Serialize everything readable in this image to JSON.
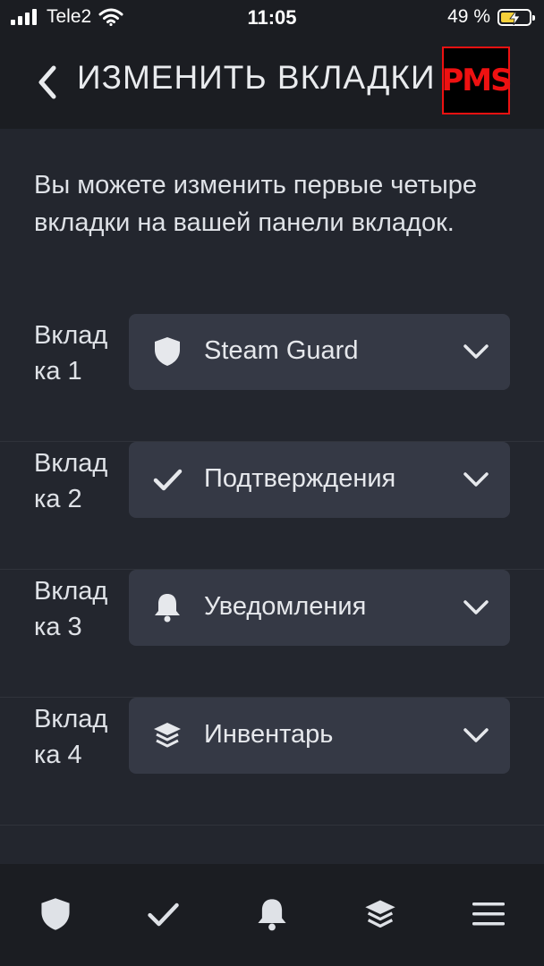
{
  "status_bar": {
    "carrier": "Tele2",
    "time": "11:05",
    "battery_percent": "49 %",
    "icons": [
      "signal-icon",
      "wifi-icon",
      "battery-charging-icon"
    ]
  },
  "header": {
    "back_icon": "chevron-left-icon",
    "title": "ИЗМЕНИТЬ ВКЛАДКИ",
    "logo_text": "PMS"
  },
  "intro_text": "Вы можете изменить первые четыре вкладки на вашей панели вкладок.",
  "tabs_config": [
    {
      "label": "Вкладка 1",
      "label_line1": "Вклад",
      "label_line2": "ка 1",
      "icon": "shield-icon",
      "value": "Steam Guard"
    },
    {
      "label": "Вкладка 2",
      "label_line1": "Вклад",
      "label_line2": "ка 2",
      "icon": "check-icon",
      "value": "Подтверждения"
    },
    {
      "label": "Вкладка 3",
      "label_line1": "Вклад",
      "label_line2": "ка 3",
      "icon": "bell-icon",
      "value": "Уведомления"
    },
    {
      "label": "Вкладка 4",
      "label_line1": "Вклад",
      "label_line2": "ка 4",
      "icon": "layers-icon",
      "value": "Инвентарь"
    }
  ],
  "tab_bar": {
    "items": [
      "shield-icon",
      "check-icon",
      "bell-icon",
      "layers-icon",
      "menu-icon"
    ]
  },
  "colors": {
    "background": "#23262e",
    "bar": "#1b1d22",
    "select_bg": "#353945",
    "logo_red": "#ee1111",
    "battery_fill": "#f5d03a"
  }
}
